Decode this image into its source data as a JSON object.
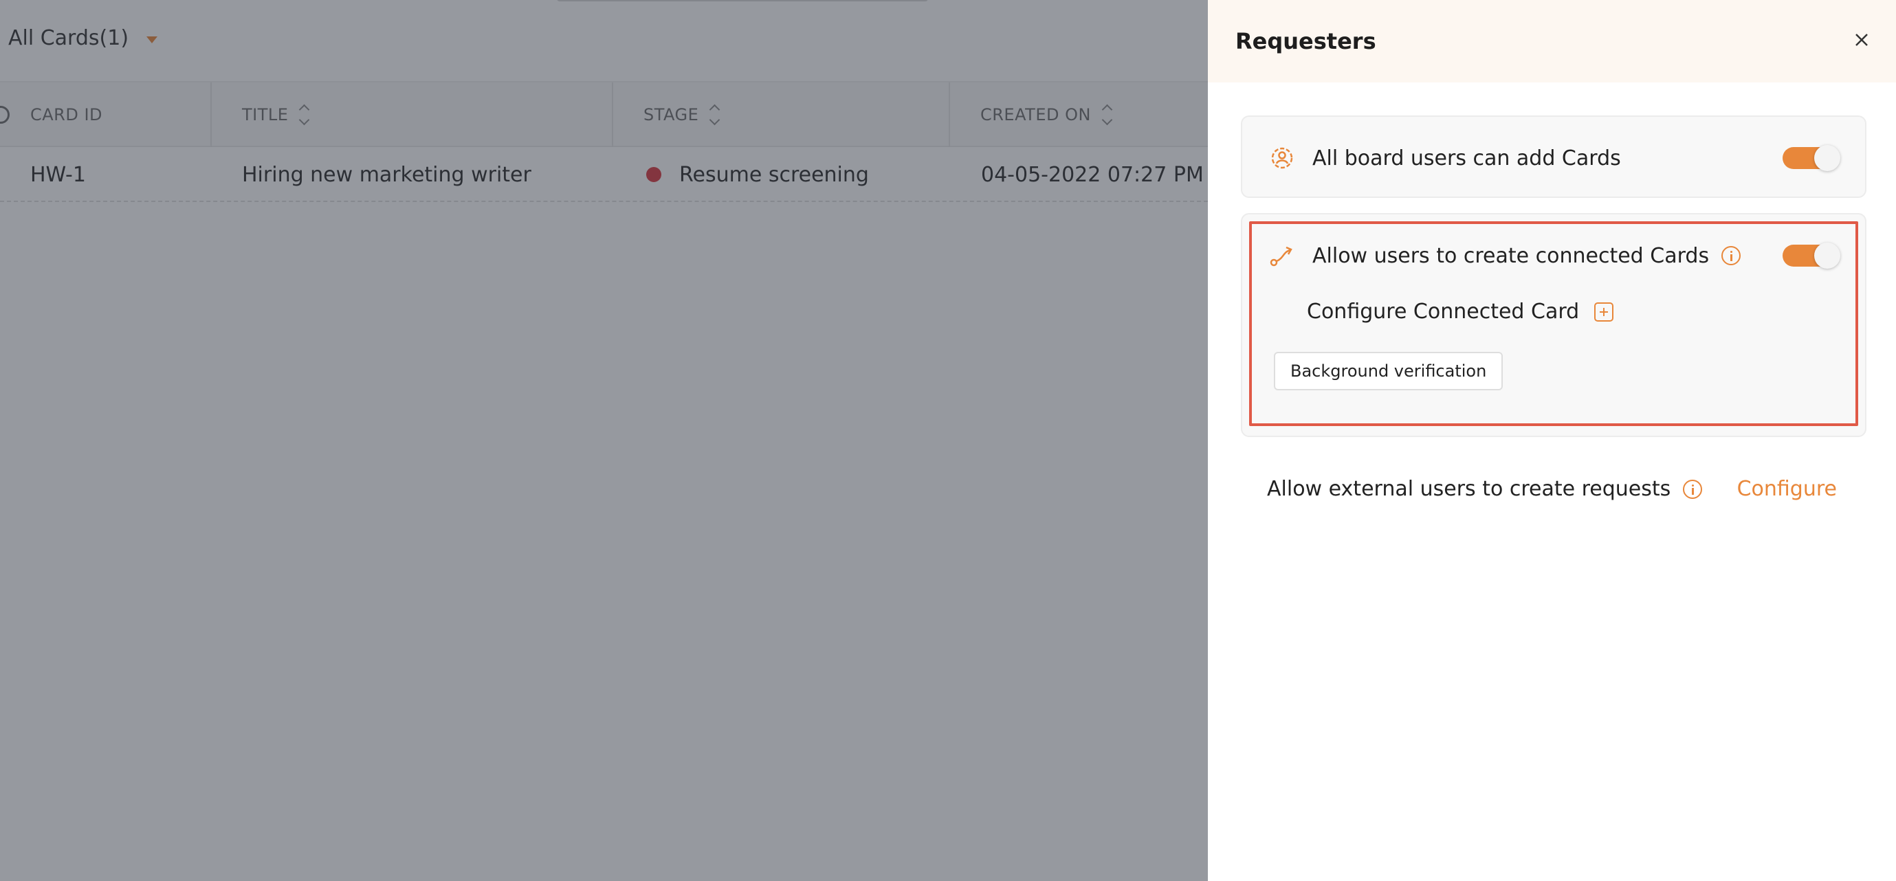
{
  "board": {
    "view_name": "All Cards(1)",
    "columns": [
      {
        "label": "CARD ID",
        "sortable": false
      },
      {
        "label": "TITLE",
        "sortable": true
      },
      {
        "label": "STAGE",
        "sortable": true
      },
      {
        "label": "CREATED ON",
        "sortable": true
      }
    ],
    "rows": [
      {
        "card_id": "HW-1",
        "title": "Hiring new marketing writer",
        "stage": "Resume screening",
        "stage_color": "#d9363e",
        "created_on": "04-05-2022 07:27 PM"
      }
    ]
  },
  "drawer": {
    "title": "Requesters",
    "options": {
      "all_users": {
        "label": "All board users can add Cards",
        "enabled": true,
        "icon": "users-gear-icon"
      },
      "connected": {
        "label": "Allow users to create connected Cards",
        "enabled": true,
        "icon": "connect-route-icon"
      }
    },
    "configure_connected_label": "Configure Connected Card",
    "connected_chip": "Background verification",
    "external": {
      "label": "Allow external users to create requests",
      "action": "Configure"
    }
  },
  "colors": {
    "accent": "#e8873a",
    "highlight": "#e05a47",
    "header_bg": "#fdf7f1"
  }
}
